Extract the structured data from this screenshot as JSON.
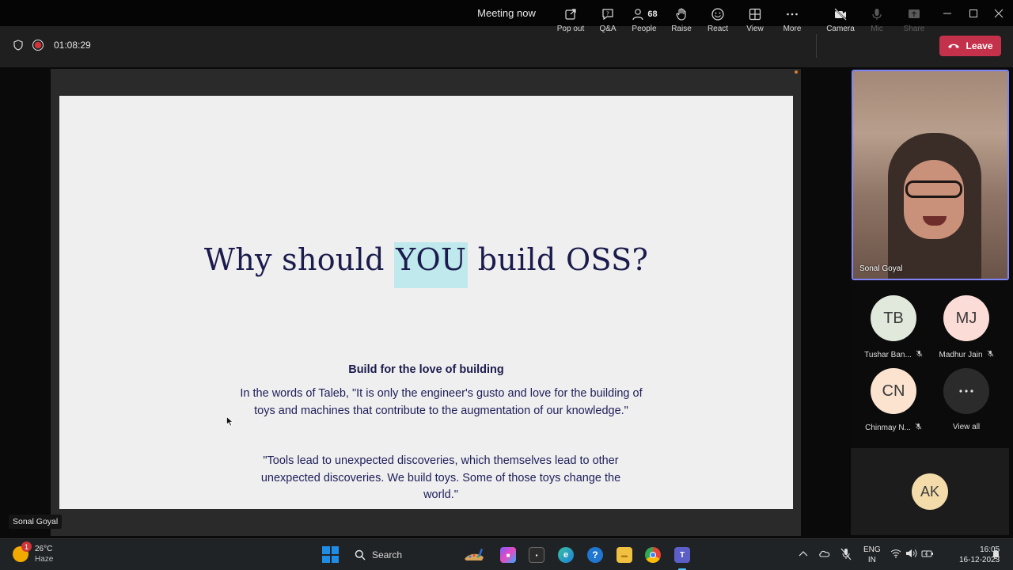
{
  "window": {
    "title": "Meeting now"
  },
  "toolbar": {
    "timer": "01:08:29",
    "buttons": [
      {
        "label": "Pop out",
        "icon": "pop-out-icon"
      },
      {
        "label": "Q&A",
        "icon": "qa-icon"
      },
      {
        "label": "People",
        "icon": "people-icon",
        "count": "68"
      },
      {
        "label": "Raise",
        "icon": "raise-hand-icon"
      },
      {
        "label": "React",
        "icon": "react-icon"
      },
      {
        "label": "View",
        "icon": "view-icon"
      },
      {
        "label": "More",
        "icon": "more-icon"
      },
      {
        "label": "Camera",
        "icon": "camera-off-icon"
      },
      {
        "label": "Mic",
        "icon": "mic-icon",
        "disabled": true
      },
      {
        "label": "Share",
        "icon": "share-icon",
        "disabled": true
      }
    ],
    "leave_label": "Leave"
  },
  "slide": {
    "title_before": "Why should ",
    "title_highlight": "YOU",
    "title_after": " build OSS?",
    "subtitle": "Build for the love of building",
    "quote1": "In the words of Taleb, \"It is only the engineer's gusto and love for the building of toys and machines that contribute to the augmentation of our knowledge.\"",
    "quote2": "\"Tools lead to unexpected discoveries, which themselves lead to other unexpected discoveries. We build toys. Some of those toys change the world.\""
  },
  "presenter_tag": "Sonal Goyal",
  "participants": {
    "video": {
      "name": "Sonal Goyal"
    },
    "tiles": [
      {
        "initials": "TB",
        "name": "Tushar Ban...",
        "color": "#e1e9dc",
        "muted": true
      },
      {
        "initials": "MJ",
        "name": "Madhur Jain",
        "color": "#fbdcd6",
        "muted": true
      },
      {
        "initials": "CN",
        "name": "Chinmay N...",
        "color": "#fbe3cf",
        "muted": true
      }
    ],
    "view_all": "View all",
    "ak": "AK"
  },
  "taskbar": {
    "weather_temp": "26°C",
    "weather_cond": "Haze",
    "weather_badge": "1",
    "search_label": "Search",
    "lang1": "ENG",
    "lang2": "IN",
    "time": "16:05",
    "date": "16-12-2023"
  }
}
